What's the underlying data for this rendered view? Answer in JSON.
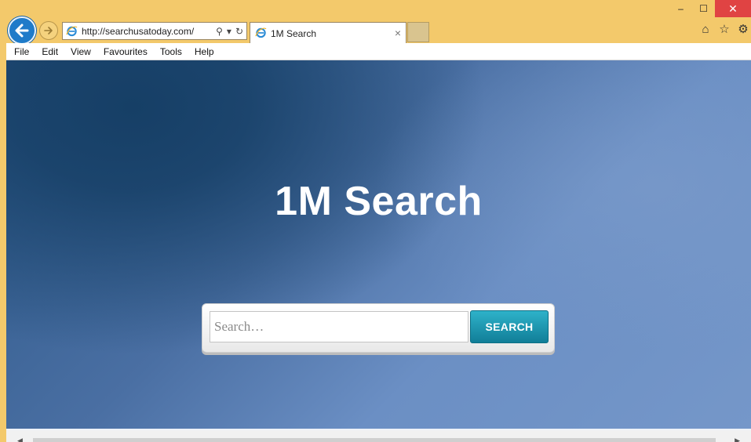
{
  "browser": {
    "address_url": "http://searchusatoday.com/",
    "search_symbol": "⚲",
    "dropdown_symbol": "▾",
    "refresh_symbol": "↻",
    "tab_title": "1M Search",
    "tab_close": "×",
    "window": {
      "minimize": "–",
      "maximize": "☐",
      "close": "✕"
    },
    "toolbar": {
      "home": "⌂",
      "favorites": "☆",
      "settings": "⚙"
    }
  },
  "menu": {
    "items": [
      {
        "label": "File"
      },
      {
        "label": "Edit"
      },
      {
        "label": "View"
      },
      {
        "label": "Favourites"
      },
      {
        "label": "Tools"
      },
      {
        "label": "Help"
      }
    ]
  },
  "page": {
    "title": "1M Search",
    "search_placeholder": "Search…",
    "search_button": "SEARCH"
  },
  "colors": {
    "chrome": "#f3c96b",
    "back_button": "#1f7bc9",
    "search_button": "#1d97b2",
    "close_button": "#e04343"
  }
}
